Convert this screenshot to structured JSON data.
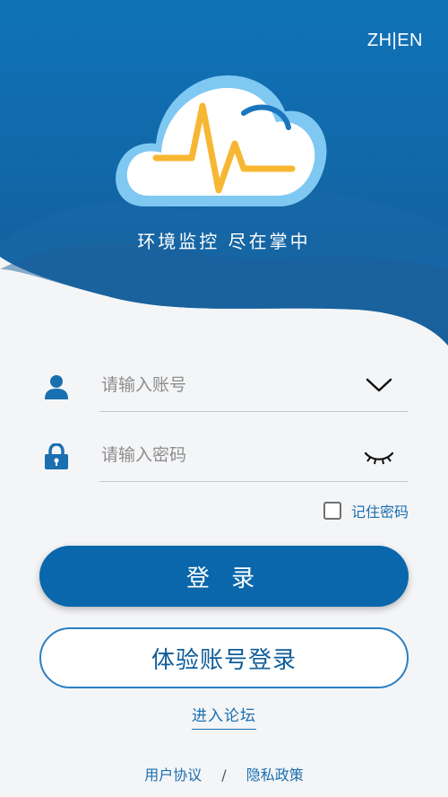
{
  "header": {
    "language_toggle": "ZH|EN",
    "tagline": "环境监控 尽在掌中"
  },
  "login_form": {
    "account_placeholder": "请输入账号",
    "password_placeholder": "请输入密码",
    "remember_label": "记住密码",
    "remember_checked": false,
    "login_button": "登 录",
    "trial_button": "体验账号登录",
    "forum_link": "进入论坛"
  },
  "footer": {
    "user_agreement": "用户协议",
    "separator": "/",
    "privacy_policy": "隐私政策"
  },
  "icons": {
    "user": "user-icon",
    "lock": "lock-icon",
    "dropdown": "chevron-down-icon",
    "password_toggle": "eye-closed-icon",
    "logo": "cloud-pulse-logo"
  },
  "colors": {
    "primary": "#0a67ab",
    "hero_top": "#0e6fb5",
    "hero_bottom": "#15568f",
    "logo_pulse": "#f7b733",
    "link": "#1a6fb0",
    "background": "#f4f5f7"
  }
}
